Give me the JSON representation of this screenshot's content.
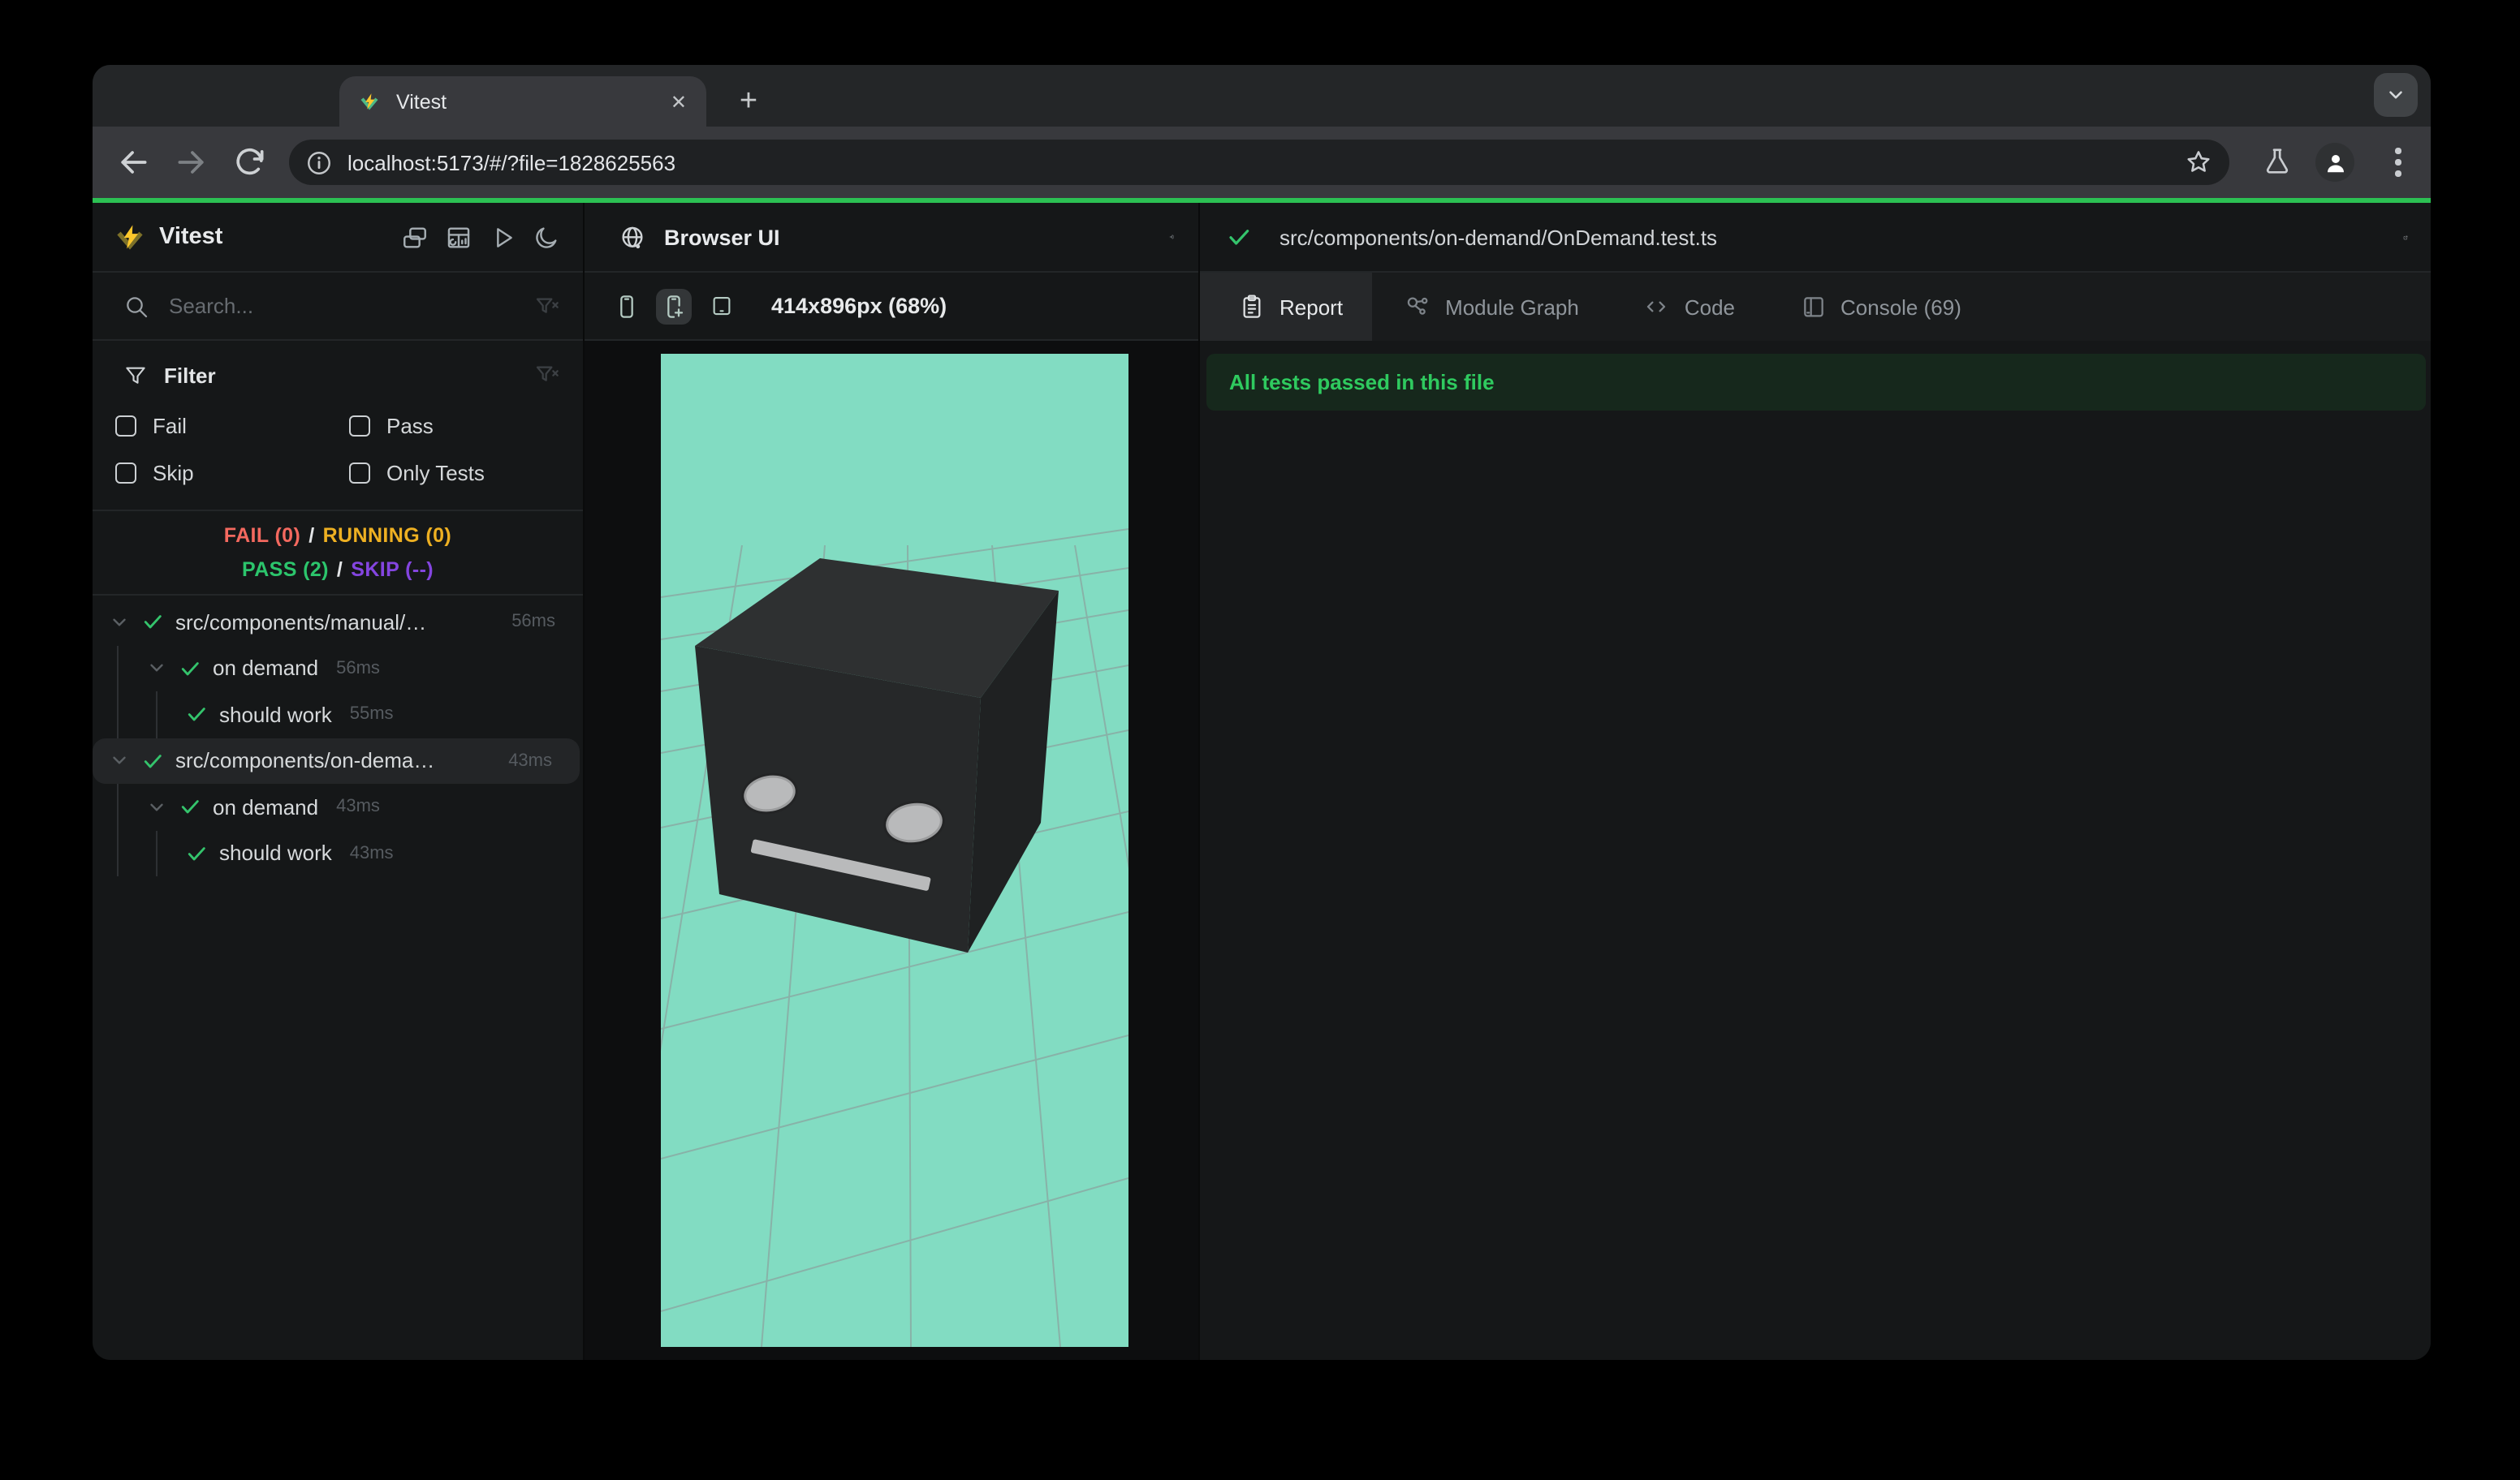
{
  "theme": {
    "bg_app": "#151718",
    "bg_preview": "#0d0e0f",
    "border": "#232628",
    "tabstrip": "#242628",
    "chrome": "#38393d",
    "pill": "#1f2123",
    "pill_btn": "#404346",
    "progress": "#2cc153",
    "strip": "#191b1c",
    "tab_active": "#26282a",
    "row_sel": "#232527",
    "banner_bg": "#16281c",
    "banner_text": "#2fca5f",
    "mint": "#82dcc2",
    "fail": "#f4695f",
    "running": "#eeb022",
    "pass": "#2cc56c",
    "skip": "#8445e0",
    "check": "#34c46c",
    "icon": "#a6aeb3",
    "device_icon": "#b5cbc3",
    "tl_red": "#ff5f57",
    "tl_yellow": "#febc2e",
    "tl_green": "#28c840"
  },
  "window": {
    "tab_title": "Vitest",
    "close_glyph": "✕",
    "new_tab_glyph": "+",
    "url": "localhost:5173/#/?file=1828625563"
  },
  "sidebar": {
    "app_title": "Vitest",
    "search_placeholder": "Search...",
    "filter": {
      "title": "Filter",
      "options": [
        {
          "label": "Fail",
          "checked": false
        },
        {
          "label": "Pass",
          "checked": false
        },
        {
          "label": "Skip",
          "checked": false
        },
        {
          "label": "Only Tests",
          "checked": false
        }
      ]
    },
    "summary": {
      "fail_label": "FAIL (0)",
      "running_label": "RUNNING (0)",
      "pass_label": "PASS (2)",
      "skip_label": "SKIP (--)",
      "separator": "/"
    },
    "tree": [
      {
        "label": "src/components/manual/…",
        "time": "56ms",
        "level": 1,
        "state": "pass",
        "selected": false
      },
      {
        "label": "on demand",
        "time": "56ms",
        "level": 2,
        "state": "pass",
        "selected": false
      },
      {
        "label": "should work",
        "time": "55ms",
        "level": 3,
        "state": "pass",
        "selected": false
      },
      {
        "label": "src/components/on-dema…",
        "time": "43ms",
        "level": 1,
        "state": "pass",
        "selected": true
      },
      {
        "label": "on demand",
        "time": "43ms",
        "level": 2,
        "state": "pass",
        "selected": false
      },
      {
        "label": "should work",
        "time": "43ms",
        "level": 3,
        "state": "pass",
        "selected": false
      }
    ]
  },
  "preview": {
    "panel_title": "Browser UI",
    "viewport_label": "414x896px (68%)"
  },
  "report": {
    "file_path": "src/components/on-demand/OnDemand.test.ts",
    "tabs": [
      {
        "label": "Report",
        "active": true
      },
      {
        "label": "Module Graph",
        "active": false
      },
      {
        "label": "Code",
        "active": false
      },
      {
        "label": "Console (69)",
        "active": false
      }
    ],
    "banner": "All tests passed in this file"
  }
}
